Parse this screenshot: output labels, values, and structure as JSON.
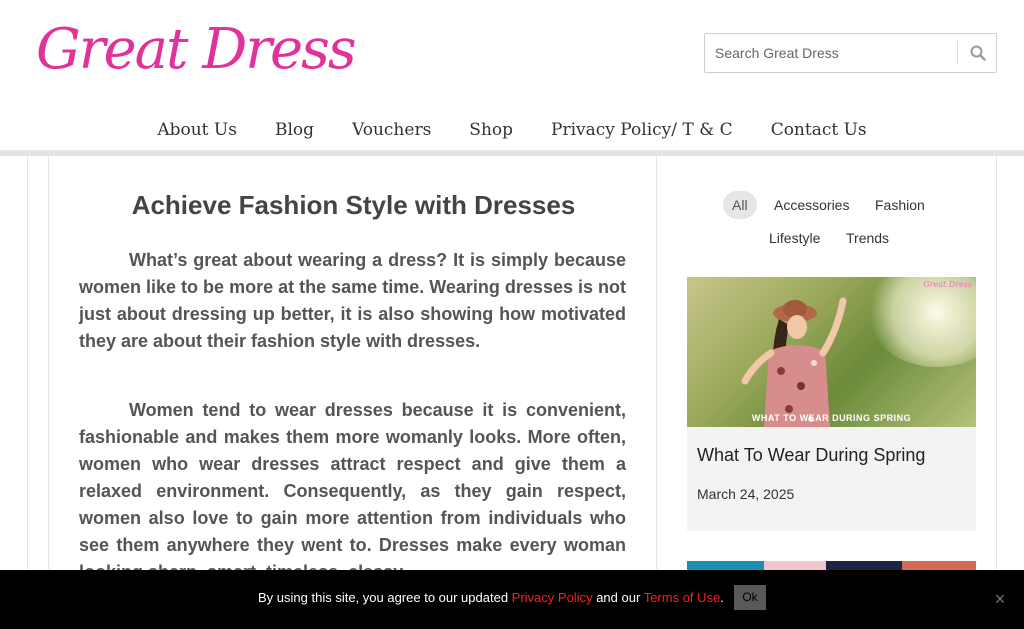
{
  "header": {
    "logo_text": "Great Dress",
    "search_placeholder": "Search Great Dress"
  },
  "nav": {
    "items": [
      {
        "label": "About Us"
      },
      {
        "label": "Blog"
      },
      {
        "label": "Vouchers"
      },
      {
        "label": "Shop"
      },
      {
        "label": "Privacy Policy/ T & C"
      },
      {
        "label": "Contact Us"
      }
    ]
  },
  "article": {
    "title": "Achieve Fashion Style with Dresses",
    "paragraphs": [
      "What’s great about wearing a dress? It is simply because women like to be more at the same time. Wearing dresses is not just about dressing up better, it is also showing how motivated they are about their fashion style with dresses.",
      "Women tend to wear dresses because it is convenient, fashionable and makes them more womanly looks. More often, women who wear dresses attract respect and give them a relaxed environment. Consequently, as they gain respect, women also love to gain more attention from individuals who see them anywhere they went to. Dresses make every woman looking sharp, smart, timeless, classy"
    ]
  },
  "sidebar": {
    "filters": [
      {
        "label": "All",
        "active": true
      },
      {
        "label": "Accessories",
        "active": false
      },
      {
        "label": "Fashion",
        "active": false
      },
      {
        "label": "Lifestyle",
        "active": false
      },
      {
        "label": "Trends",
        "active": false
      }
    ],
    "post": {
      "image_caption": "WHAT TO WEAR DURING SPRING",
      "image_watermark": "Great Dress",
      "title": "What To Wear During Spring",
      "date": "March 24, 2025"
    }
  },
  "cookie": {
    "text_before": "By using this site, you agree to our updated ",
    "privacy_link": "Privacy Policy",
    "text_middle": " and our ",
    "terms_link": "Terms of Use",
    "text_after": ".",
    "ok_label": "Ok",
    "close_label": "×"
  },
  "colors": {
    "logo": "#e0329a",
    "link_red": "#ff1f1f",
    "cookie_bg": "#000000"
  }
}
